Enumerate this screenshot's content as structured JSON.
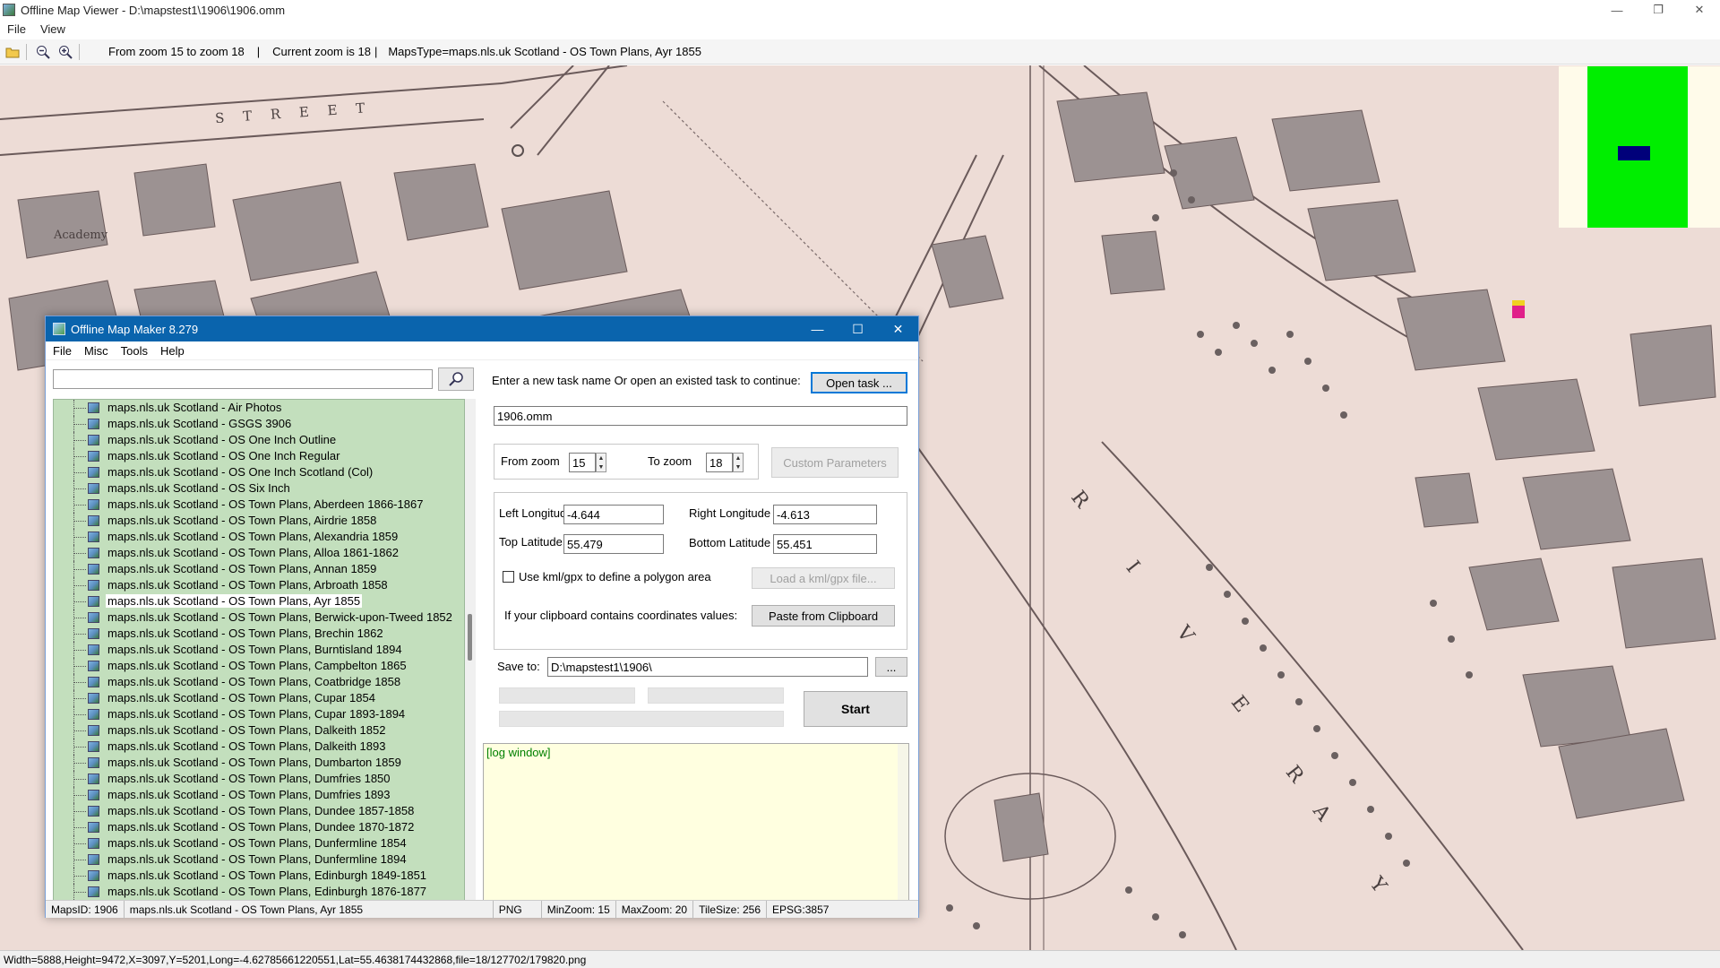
{
  "window": {
    "title": "Offline Map Viewer - D:\\mapstest1\\1906\\1906.omm",
    "controls": {
      "minimize": "—",
      "restore": "❐",
      "close": "✕"
    }
  },
  "menu": [
    "File",
    "View"
  ],
  "toolbar": {
    "zoom_range": "From zoom 15 to zoom 18",
    "separator": "|",
    "current_zoom": "Current zoom is 18",
    "maps_type": "MapsType=maps.nls.uk Scotland - OS Town Plans, Ayr 1855"
  },
  "map": {
    "labels": [
      "Academy",
      "S T R E E T",
      "R I V E R",
      "A Y"
    ],
    "colors": {
      "paper": "#eddcd6",
      "ink": "#5a5050",
      "building": "#9c9292"
    }
  },
  "overview": {
    "background": "#fffbea",
    "frame": "#00ee00",
    "viewport": "#00007a"
  },
  "statusbar": {
    "text": "Width=5888,Height=9472,X=3097,Y=5201,Long=-4.62785661220551,Lat=55.4638174432868,file=18/127702/179820.png"
  },
  "dialog": {
    "title": "Offline Map Maker 8.279",
    "controls": {
      "minimize": "—",
      "maximize": "☐",
      "close": "✕"
    },
    "menu": [
      "File",
      "Misc",
      "Tools",
      "Help"
    ],
    "search": {
      "value": "",
      "placeholder": ""
    },
    "tree_items": [
      "maps.nls.uk Scotland - Air Photos",
      "maps.nls.uk Scotland - GSGS 3906",
      "maps.nls.uk Scotland - OS One Inch Outline",
      "maps.nls.uk Scotland - OS One Inch Regular",
      "maps.nls.uk Scotland - OS One Inch Scotland (Col)",
      "maps.nls.uk Scotland - OS Six Inch",
      "maps.nls.uk Scotland - OS Town Plans, Aberdeen 1866-1867",
      "maps.nls.uk Scotland - OS Town Plans, Airdrie 1858",
      "maps.nls.uk Scotland - OS Town Plans, Alexandria 1859",
      "maps.nls.uk Scotland - OS Town Plans, Alloa 1861-1862",
      "maps.nls.uk Scotland - OS Town Plans, Annan 1859",
      "maps.nls.uk Scotland - OS Town Plans, Arbroath 1858",
      "maps.nls.uk Scotland - OS Town Plans, Ayr 1855",
      "maps.nls.uk Scotland - OS Town Plans, Berwick-upon-Tweed 1852",
      "maps.nls.uk Scotland - OS Town Plans, Brechin 1862",
      "maps.nls.uk Scotland - OS Town Plans, Burntisland 1894",
      "maps.nls.uk Scotland - OS Town Plans, Campbelton 1865",
      "maps.nls.uk Scotland - OS Town Plans, Coatbridge 1858",
      "maps.nls.uk Scotland - OS Town Plans, Cupar 1854",
      "maps.nls.uk Scotland - OS Town Plans, Cupar 1893-1894",
      "maps.nls.uk Scotland - OS Town Plans, Dalkeith 1852",
      "maps.nls.uk Scotland - OS Town Plans, Dalkeith 1893",
      "maps.nls.uk Scotland - OS Town Plans, Dumbarton 1859",
      "maps.nls.uk Scotland - OS Town Plans, Dumfries 1850",
      "maps.nls.uk Scotland - OS Town Plans, Dumfries 1893",
      "maps.nls.uk Scotland - OS Town Plans, Dundee 1857-1858",
      "maps.nls.uk Scotland - OS Town Plans, Dundee 1870-1872",
      "maps.nls.uk Scotland - OS Town Plans, Dunfermline 1854",
      "maps.nls.uk Scotland - OS Town Plans, Dunfermline 1894",
      "maps.nls.uk Scotland - OS Town Plans, Edinburgh 1849-1851",
      "maps.nls.uk Scotland - OS Town Plans, Edinburgh 1876-1877"
    ],
    "selected_index": 12,
    "task": {
      "prompt": "Enter a new task name Or open an existed task to continue:",
      "open_label": "Open task ...",
      "name_value": "1906.omm"
    },
    "zoom": {
      "from_label": "From zoom",
      "from_value": "15",
      "to_label": "To zoom",
      "to_value": "18",
      "custom_label": "Custom Parameters"
    },
    "coords": {
      "left_lon_label": "Left Longitude",
      "left_lon": "-4.644",
      "right_lon_label": "Right Longitude",
      "right_lon": "-4.613",
      "top_lat_label": "Top Latitude",
      "top_lat": "55.479",
      "bottom_lat_label": "Bottom Latitude",
      "bottom_lat": "55.451",
      "kml_label": "Use kml/gpx to define a polygon area",
      "kml_checked": false,
      "load_kml_label": "Load a kml/gpx file...",
      "clipboard_label": "If your clipboard contains coordinates values:",
      "paste_label": "Paste from Clipboard"
    },
    "save": {
      "label": "Save to:",
      "value": "D:\\mapstest1\\1906\\",
      "browse_label": "..."
    },
    "start_label": "Start",
    "log_text": "[log window]",
    "status": {
      "maps_id": "MapsID: 1906",
      "map_name": "maps.nls.uk Scotland - OS Town Plans, Ayr 1855",
      "format": "PNG",
      "min_zoom": "MinZoom: 15",
      "max_zoom": "MaxZoom: 20",
      "tile_size": "TileSize: 256",
      "epsg": "EPSG:3857"
    }
  }
}
